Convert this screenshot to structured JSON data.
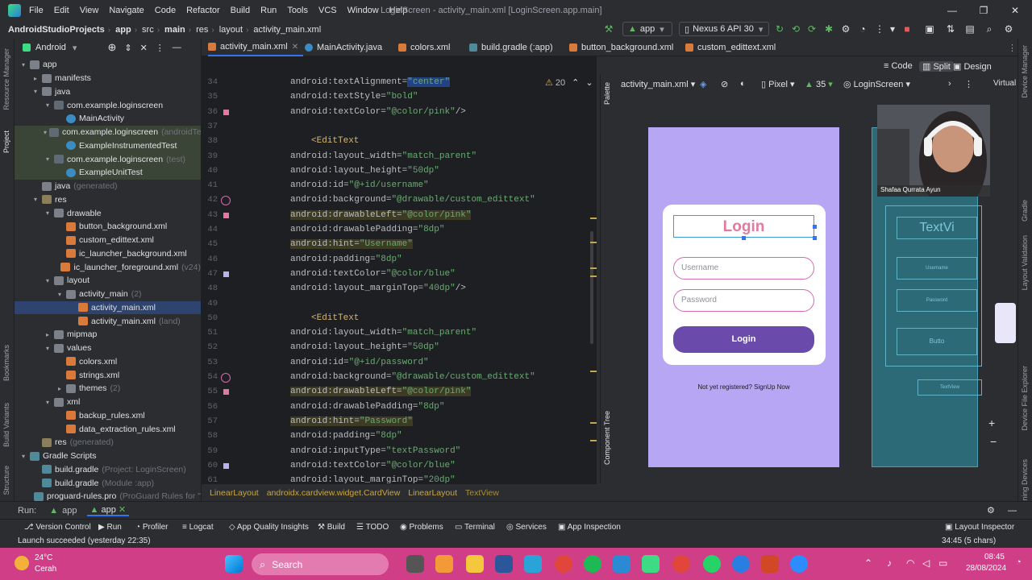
{
  "menu": {
    "items": [
      "File",
      "Edit",
      "View",
      "Navigate",
      "Code",
      "Refactor",
      "Build",
      "Run",
      "Tools",
      "VCS",
      "Window",
      "Help"
    ],
    "window_title": "LoginScreen - activity_main.xml [LoginScreen.app.main]"
  },
  "nav": {
    "crumbs": [
      "AndroidStudioProjects",
      "app",
      "src",
      "main",
      "res",
      "layout",
      "activity_main.xml"
    ],
    "run_config": "app",
    "device": "Nexus 6 API 30"
  },
  "project": {
    "view_label": "Android",
    "tree": [
      {
        "label": "app",
        "indent": 0,
        "arrow": "▾",
        "icon": "ic-folder",
        "hint": ""
      },
      {
        "label": "manifests",
        "indent": 1,
        "arrow": "▸",
        "icon": "ic-folder",
        "hint": ""
      },
      {
        "label": "java",
        "indent": 1,
        "arrow": "▾",
        "icon": "ic-folder",
        "hint": ""
      },
      {
        "label": "com.example.loginscreen",
        "indent": 2,
        "arrow": "▾",
        "icon": "ic-pkg",
        "hint": ""
      },
      {
        "label": "MainActivity",
        "indent": 3,
        "arrow": "",
        "icon": "ic-java",
        "hint": ""
      },
      {
        "label": "com.example.loginscreen",
        "indent": 2,
        "arrow": "▾",
        "icon": "ic-pkg",
        "hint": "(androidTest)",
        "hl": true
      },
      {
        "label": "ExampleInstrumentedTest",
        "indent": 3,
        "arrow": "",
        "icon": "ic-java",
        "hint": "",
        "hl": true
      },
      {
        "label": "com.example.loginscreen",
        "indent": 2,
        "arrow": "▾",
        "icon": "ic-pkg",
        "hint": "(test)",
        "hl": true
      },
      {
        "label": "ExampleUnitTest",
        "indent": 3,
        "arrow": "",
        "icon": "ic-java",
        "hint": "",
        "hl": true
      },
      {
        "label": "java",
        "indent": 1,
        "arrow": "",
        "icon": "ic-folder",
        "hint": "(generated)"
      },
      {
        "label": "res",
        "indent": 1,
        "arrow": "▾",
        "icon": "ic-res",
        "hint": ""
      },
      {
        "label": "drawable",
        "indent": 2,
        "arrow": "▾",
        "icon": "ic-folder",
        "hint": ""
      },
      {
        "label": "button_background.xml",
        "indent": 3,
        "arrow": "",
        "icon": "ic-xml",
        "hint": ""
      },
      {
        "label": "custom_edittext.xml",
        "indent": 3,
        "arrow": "",
        "icon": "ic-xml",
        "hint": ""
      },
      {
        "label": "ic_launcher_background.xml",
        "indent": 3,
        "arrow": "",
        "icon": "ic-xml",
        "hint": ""
      },
      {
        "label": "ic_launcher_foreground.xml",
        "indent": 3,
        "arrow": "",
        "icon": "ic-xml",
        "hint": "(v24)"
      },
      {
        "label": "layout",
        "indent": 2,
        "arrow": "▾",
        "icon": "ic-folder",
        "hint": ""
      },
      {
        "label": "activity_main",
        "indent": 3,
        "arrow": "▾",
        "icon": "ic-folder",
        "hint": "(2)"
      },
      {
        "label": "activity_main.xml",
        "indent": 4,
        "arrow": "",
        "icon": "ic-xml",
        "hint": "",
        "sel": true
      },
      {
        "label": "activity_main.xml",
        "indent": 4,
        "arrow": "",
        "icon": "ic-xml",
        "hint": "(land)"
      },
      {
        "label": "mipmap",
        "indent": 2,
        "arrow": "▸",
        "icon": "ic-folder",
        "hint": ""
      },
      {
        "label": "values",
        "indent": 2,
        "arrow": "▾",
        "icon": "ic-folder",
        "hint": ""
      },
      {
        "label": "colors.xml",
        "indent": 3,
        "arrow": "",
        "icon": "ic-xml",
        "hint": ""
      },
      {
        "label": "strings.xml",
        "indent": 3,
        "arrow": "",
        "icon": "ic-xml",
        "hint": ""
      },
      {
        "label": "themes",
        "indent": 3,
        "arrow": "▸",
        "icon": "ic-folder",
        "hint": "(2)"
      },
      {
        "label": "xml",
        "indent": 2,
        "arrow": "▾",
        "icon": "ic-folder",
        "hint": ""
      },
      {
        "label": "backup_rules.xml",
        "indent": 3,
        "arrow": "",
        "icon": "ic-xml",
        "hint": ""
      },
      {
        "label": "data_extraction_rules.xml",
        "indent": 3,
        "arrow": "",
        "icon": "ic-xml",
        "hint": ""
      },
      {
        "label": "res",
        "indent": 1,
        "arrow": "",
        "icon": "ic-res",
        "hint": "(generated)"
      },
      {
        "label": "Gradle Scripts",
        "indent": 0,
        "arrow": "▾",
        "icon": "ic-gradle",
        "hint": ""
      },
      {
        "label": "build.gradle",
        "indent": 1,
        "arrow": "",
        "icon": "ic-gradle",
        "hint": "(Project: LoginScreen)"
      },
      {
        "label": "build.gradle",
        "indent": 1,
        "arrow": "",
        "icon": "ic-gradle",
        "hint": "(Module :app)"
      },
      {
        "label": "proguard-rules.pro",
        "indent": 1,
        "arrow": "",
        "icon": "ic-gradle",
        "hint": "(ProGuard Rules for \":"
      }
    ]
  },
  "tabs": [
    "activity_main.xml",
    "MainActivity.java",
    "colors.xml",
    "build.gradle (:app)",
    "button_background.xml",
    "custom_edittext.xml"
  ],
  "view_modes": {
    "code": "Code",
    "split": "Split",
    "design": "Design"
  },
  "warnings": "20",
  "code_lines": [
    {
      "n": "34",
      "ns": "android",
      "attr": "textAlignment",
      "val": "\"center\"",
      "tail": "",
      "kind": "attr",
      "sel": true
    },
    {
      "n": "35",
      "ns": "android",
      "attr": "textStyle",
      "val": "\"bold\"",
      "tail": "",
      "kind": "attr"
    },
    {
      "n": "36",
      "ns": "android",
      "attr": "textColor",
      "val": "\"@color/pink\"",
      "tail": "/>",
      "kind": "attr",
      "mark": "#e07ba0"
    },
    {
      "n": "37",
      "kind": "blank"
    },
    {
      "n": "38",
      "text": "<EditText",
      "kind": "tag"
    },
    {
      "n": "39",
      "ns": "android",
      "attr": "layout_width",
      "val": "\"match_parent\"",
      "tail": "",
      "kind": "attr"
    },
    {
      "n": "40",
      "ns": "android",
      "attr": "layout_height",
      "val": "\"50dp\"",
      "tail": "",
      "kind": "attr"
    },
    {
      "n": "41",
      "ns": "android",
      "attr": "id",
      "val": "\"@+id/username\"",
      "tail": "",
      "kind": "attr"
    },
    {
      "n": "42",
      "ns": "android",
      "attr": "background",
      "val": "\"@drawable/custom_edittext\"",
      "tail": "",
      "kind": "attr",
      "ring": true
    },
    {
      "n": "43",
      "ns": "android",
      "attr": "drawableLeft",
      "val": "\"@color/pink\"",
      "tail": "",
      "kind": "attr",
      "hl": true,
      "mark": "#e07ba0"
    },
    {
      "n": "44",
      "ns": "android",
      "attr": "drawablePadding",
      "val": "\"8dp\"",
      "tail": "",
      "kind": "attr"
    },
    {
      "n": "45",
      "ns": "android",
      "attr": "hint",
      "val": "\"Username\"",
      "tail": "",
      "kind": "attr",
      "hl": true
    },
    {
      "n": "46",
      "ns": "android",
      "attr": "padding",
      "val": "\"8dp\"",
      "tail": "",
      "kind": "attr"
    },
    {
      "n": "47",
      "ns": "android",
      "attr": "textColor",
      "val": "\"@color/blue\"",
      "tail": "",
      "kind": "attr",
      "mark": "#b9b2f0"
    },
    {
      "n": "48",
      "ns": "android",
      "attr": "layout_marginTop",
      "val": "\"40dp\"",
      "tail": "/>",
      "kind": "attr"
    },
    {
      "n": "49",
      "kind": "blank"
    },
    {
      "n": "50",
      "text": "<EditText",
      "kind": "tag"
    },
    {
      "n": "51",
      "ns": "android",
      "attr": "layout_width",
      "val": "\"match_parent\"",
      "tail": "",
      "kind": "attr"
    },
    {
      "n": "52",
      "ns": "android",
      "attr": "layout_height",
      "val": "\"50dp\"",
      "tail": "",
      "kind": "attr"
    },
    {
      "n": "53",
      "ns": "android",
      "attr": "id",
      "val": "\"@+id/password\"",
      "tail": "",
      "kind": "attr"
    },
    {
      "n": "54",
      "ns": "android",
      "attr": "background",
      "val": "\"@drawable/custom_edittext\"",
      "tail": "",
      "kind": "attr",
      "ring": true
    },
    {
      "n": "55",
      "ns": "android",
      "attr": "drawableLeft",
      "val": "\"@color/pink\"",
      "tail": "",
      "kind": "attr",
      "hl": true,
      "mark": "#e07ba0"
    },
    {
      "n": "56",
      "ns": "android",
      "attr": "drawablePadding",
      "val": "\"8dp\"",
      "tail": "",
      "kind": "attr"
    },
    {
      "n": "57",
      "ns": "android",
      "attr": "hint",
      "val": "\"Password\"",
      "tail": "",
      "kind": "attr",
      "hl": true
    },
    {
      "n": "58",
      "ns": "android",
      "attr": "padding",
      "val": "\"8dp\"",
      "tail": "",
      "kind": "attr"
    },
    {
      "n": "59",
      "ns": "android",
      "attr": "inputType",
      "val": "\"textPassword\"",
      "tail": "",
      "kind": "attr"
    },
    {
      "n": "60",
      "ns": "android",
      "attr": "textColor",
      "val": "\"@color/blue\"",
      "tail": "",
      "kind": "attr",
      "mark": "#b9b2f0"
    },
    {
      "n": "61",
      "ns": "android",
      "attr": "layout_marginTop",
      "val": "\"20dp\"",
      "tail": "",
      "kind": "attr"
    }
  ],
  "breadcrumb_path": [
    "LinearLayout",
    "androidx.cardview.widget.CardView",
    "LinearLayout",
    "TextView"
  ],
  "design": {
    "file": "activity_main.xml",
    "device": "Pixel",
    "api": "35",
    "theme": "LoginScreen",
    "palette_label": "Palette",
    "component_tree_label": "Component Tree",
    "virtual_label": "Virtual"
  },
  "preview": {
    "title": "Login",
    "username_hint": "Username",
    "password_hint": "Password",
    "button_label": "Login",
    "signup": "Not yet registered? SignUp Now",
    "bg_color": "#b7a6f4",
    "button_color": "#6a4bab",
    "title_color": "#e27aa0"
  },
  "blueprint": {
    "title": "TextVi",
    "field1": "Username",
    "field2": "Password",
    "button": "Butto",
    "link": "TextView"
  },
  "webcam": {
    "name": "Shafaa Qurrata Ayun"
  },
  "run": {
    "label": "Run:",
    "config1": "app",
    "config2": "app"
  },
  "bottom_tools": [
    "Version Control",
    "Run",
    "Profiler",
    "Logcat",
    "App Quality Insights",
    "Build",
    "TODO",
    "Problems",
    "Terminal",
    "Services",
    "App Inspection"
  ],
  "layout_inspector": "Layout Inspector",
  "status": {
    "message": "Launch succeeded (yesterday 22:35)",
    "position": "34:45 (5 chars)"
  },
  "side_labels": {
    "left": [
      "Resource Manager",
      "Project",
      "Bookmarks",
      "Build Variants",
      "Structure"
    ],
    "right": [
      "Device Manager",
      "Gradle",
      "Layout Validation",
      "Device File Explorer",
      "Running Devices"
    ]
  },
  "taskbar": {
    "weather_temp": "24°C",
    "weather_desc": "Cerah",
    "search": "Search",
    "time": "08:45",
    "date": "28/08/2024"
  }
}
